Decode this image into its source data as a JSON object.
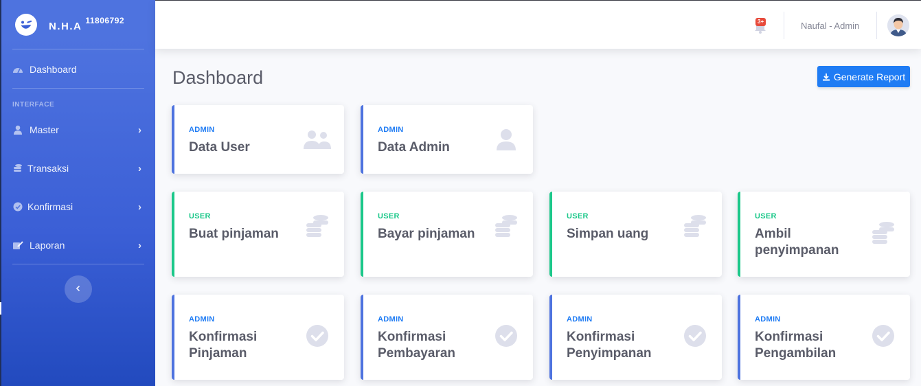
{
  "brand": {
    "name": "N.H.A",
    "id": "11806792"
  },
  "sidebar": {
    "dashboard": "Dashboard",
    "section_heading": "INTERFACE",
    "items": [
      {
        "label": "Master",
        "icon": "user-icon"
      },
      {
        "label": "Transaksi",
        "icon": "coins-icon"
      },
      {
        "label": "Konfirmasi",
        "icon": "check-circle-icon"
      },
      {
        "label": "Laporan",
        "icon": "edit-icon"
      }
    ]
  },
  "topbar": {
    "alert_badge": "3+",
    "user_name": "Naufal - Admin"
  },
  "page": {
    "title": "Dashboard",
    "report_button": "Generate Report"
  },
  "cards": [
    {
      "category": "ADMIN",
      "title": "Data User",
      "icon": "users-icon"
    },
    {
      "category": "ADMIN",
      "title": "Data Admin",
      "icon": "user-icon"
    },
    {
      "category": "USER",
      "title": "Buat pinjaman",
      "icon": "coins-icon"
    },
    {
      "category": "USER",
      "title": "Bayar pinjaman",
      "icon": "coins-icon"
    },
    {
      "category": "USER",
      "title": "Simpan uang",
      "icon": "coins-icon"
    },
    {
      "category": "USER",
      "title": "Ambil penyimpanan",
      "icon": "coins-icon"
    },
    {
      "category": "ADMIN",
      "title": "Konfirmasi Pinjaman",
      "icon": "check-circle-icon"
    },
    {
      "category": "ADMIN",
      "title": "Konfirmasi Pembayaran",
      "icon": "check-circle-icon"
    },
    {
      "category": "ADMIN",
      "title": "Konfirmasi Penyimpanan",
      "icon": "check-circle-icon"
    },
    {
      "category": "ADMIN",
      "title": "Konfirmasi Pengambilan",
      "icon": "check-circle-icon"
    }
  ],
  "colors": {
    "primary": "#4e73df",
    "success": "#1cc88a",
    "button": "#1f7cf4",
    "danger": "#e74a3b",
    "text": "#5a5c69"
  }
}
